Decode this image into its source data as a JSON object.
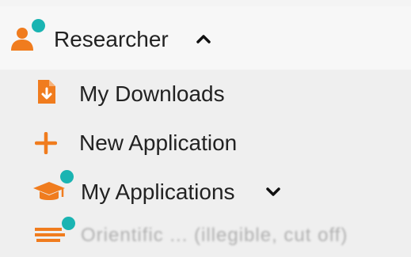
{
  "colors": {
    "accent": "#f07c1e",
    "badge": "#1ab4b2",
    "text": "#222222",
    "panel_background": "#efefef"
  },
  "user_menu": {
    "label": "Researcher",
    "icon": "user-icon",
    "expanded": true,
    "expand_icon": "chevron-up-icon"
  },
  "menu_items": [
    {
      "label": "My Downloads",
      "icon": "file-download-icon"
    },
    {
      "label": "New Application",
      "icon": "plus-icon"
    },
    {
      "label": "My Applications",
      "icon": "graduation-cap-icon",
      "expand_icon": "chevron-down-icon"
    },
    {
      "label": "Orientific ... (illegible, cut off)",
      "icon": "list-icon"
    }
  ]
}
